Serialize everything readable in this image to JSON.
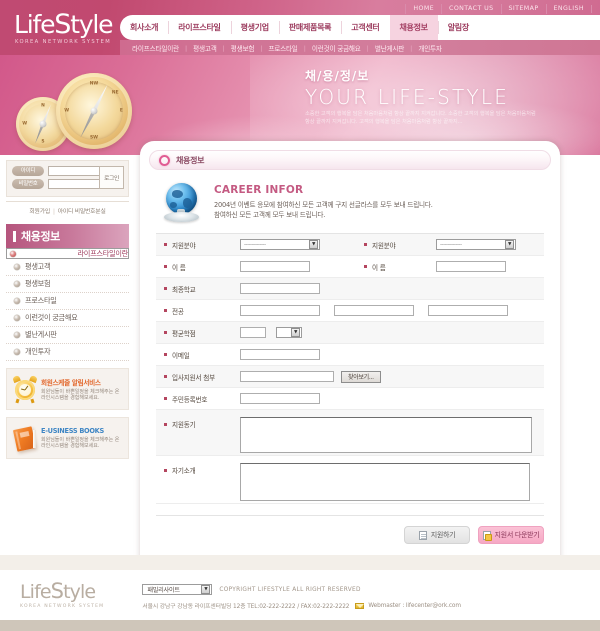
{
  "brand": {
    "name_part1": "Life",
    "name_part2": "S",
    "name_part3": "tyle",
    "tagline": "KOREA NETWORK SYSTEM"
  },
  "utility": {
    "items": [
      "HOME",
      "CONTACT US",
      "SITEMAP",
      "ENGLISH"
    ]
  },
  "gnb": {
    "items": [
      {
        "label": "회사소개",
        "active": false
      },
      {
        "label": "라이프스타일",
        "active": false
      },
      {
        "label": "평생기업",
        "active": false
      },
      {
        "label": "판매제품목록",
        "active": false
      },
      {
        "label": "고객센터",
        "active": false
      },
      {
        "label": "채용정보",
        "active": true
      },
      {
        "label": "알림장",
        "active": false
      }
    ]
  },
  "snb": {
    "items": [
      "라이프스타일이란",
      "평생고객",
      "평생보험",
      "프로스타일",
      "이런것이 궁금해요",
      "별난게시판",
      "개인투자"
    ]
  },
  "hero": {
    "kr_title": "채/용/정/보",
    "en_title": "YOUR LIFE-STYLE",
    "tagline": "소중한 고객의 행복을 담은 처음마음처럼 항상 끝까지 지켜갑니다. 소중한 고객의 행복을 담은 처음마음처럼 항상 끝까지 지켜갑니다. 고객의 행복을 담은 처음마음처럼 항상 끝까지..."
  },
  "login": {
    "id_label": "아이디",
    "pw_label": "비밀번호",
    "id_value": "",
    "pw_value": "",
    "submit_label": "로그인",
    "join_link": "회원가입",
    "find_link": "아이디 비밀번호분실"
  },
  "sidebar": {
    "title": "채용정보",
    "menu": [
      {
        "label": "라이프스타일이란",
        "selected": true
      },
      {
        "label": "평생고객",
        "selected": false
      },
      {
        "label": "평생보험",
        "selected": false
      },
      {
        "label": "프로스타일",
        "selected": false
      },
      {
        "label": "이런것이 궁금해요",
        "selected": false
      },
      {
        "label": "별난게시판",
        "selected": false
      },
      {
        "label": "개인투자",
        "selected": false
      }
    ],
    "banners": [
      {
        "icon": "alarm-clock-icon",
        "title": "회원스케줄 알림서비스",
        "desc": "회원님들이 바쁜일정을 체크해주는 온라인시스템을 경험해보세요.",
        "color": "#e2662a"
      },
      {
        "icon": "book-icon",
        "title": "E-USINESS BOOKS",
        "desc": "회원님들이 바쁜일정을 체크해주는 온라인시스템을 경험해보세요.",
        "color": "#3f86c4"
      }
    ]
  },
  "panel": {
    "header_title": "채용정보",
    "intro_heading": "CAREER INFOR",
    "intro_line1": "2004년 이벤트 응모에 참여하신 모든 고객께 구지 선글라스를 모두 보내 드립니다.",
    "intro_line2": "참여하신 모든 고객께 모두 보내 드립니다."
  },
  "form": {
    "rows": [
      {
        "label_left": "지원분야",
        "label_right": "지원분야",
        "select_value": "--------------"
      },
      {
        "label_left": "이  름",
        "label_right": "이  름",
        "value": ""
      },
      {
        "label": "최종학교",
        "value": ""
      },
      {
        "label": "전공",
        "value1": "",
        "value2": "",
        "value3": ""
      },
      {
        "label": "평균학점",
        "score_value": "",
        "grade_select": ""
      },
      {
        "label": "이메일",
        "value": ""
      },
      {
        "label": "입사지원서 첨부",
        "value": "",
        "browse_label": "찾아보기..."
      },
      {
        "label": "주민등록번호",
        "value": ""
      },
      {
        "label": "지원동기",
        "value": ""
      },
      {
        "label": "자기소개",
        "value": ""
      }
    ],
    "labels": {
      "field_left": "지원분야",
      "field_right": "지원분야",
      "name_left": "이  름",
      "name_right": "이  름",
      "school": "최종학교",
      "major": "전공",
      "gpa": "평균학점",
      "email": "이메일",
      "attach": "입사지원서 첨부",
      "ssn": "주민등록번호",
      "motive": "지원동기",
      "selfintro": "자기소개"
    },
    "select_placeholder": "--------------",
    "browse_label": "찾아보기...",
    "submit_label": "지원하기",
    "download_label": "지원서 다운받기"
  },
  "footer": {
    "family_site": "패밀리사이트",
    "copyright": "COPYRIGHT LIFESTYLE ALL RIGHT RESERVED",
    "address": "서울시 강남구 강남동 라이프센터빌딩 12층 TEL:02-222-2222 / FAX:02-222-2222",
    "webmaster": "Webmaster : lifecenter@ork.com"
  },
  "colors": {
    "header_pink": "#c04a72",
    "accent_pink": "#e05c93",
    "hero_pink": "#e58fae",
    "active_tab": "#f6d3e0",
    "sidebar_title": "#b5557d"
  }
}
